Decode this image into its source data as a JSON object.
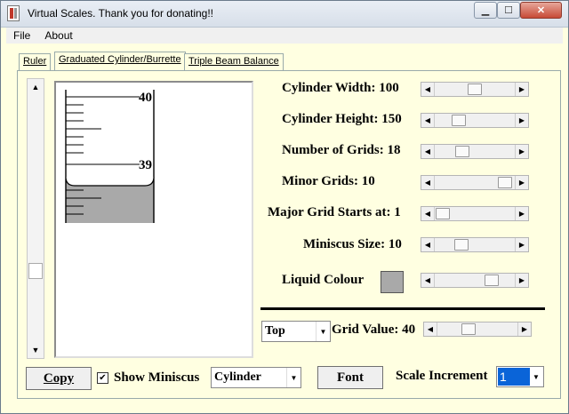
{
  "window": {
    "title": "Virtual Scales.  Thank you for donating!!"
  },
  "menu": {
    "file": "File",
    "about": "About"
  },
  "tabs": {
    "ruler": "Ruler",
    "cylinder": "Graduated Cylinder/Burrette",
    "balance": "Triple Beam Balance"
  },
  "cylinder_view": {
    "upper_label": "40",
    "lower_label": "39",
    "liquid_color": "#a9a9a9"
  },
  "controls": {
    "width": {
      "label": "Cylinder Width: 100",
      "level": 0.5
    },
    "height": {
      "label": "Cylinder Height: 150",
      "level": 0.26
    },
    "grids": {
      "label": "Number of Grids: 18",
      "level": 0.31
    },
    "minor": {
      "label": "Minor Grids: 10",
      "level": 0.96
    },
    "major_start": {
      "label": "Major Grid Starts at: 1",
      "level": 0.02
    },
    "miniscus": {
      "label": "Miniscus Size: 10",
      "level": 0.3
    },
    "colour": {
      "label": "Liquid Colour",
      "level": 0.75
    }
  },
  "grid_value": {
    "position": "Top",
    "label": "Grid Value: 40",
    "level": 0.36
  },
  "bottom": {
    "copy": "Copy",
    "show_miniscus": "Show Miniscus",
    "show_miniscus_checked": true,
    "view_type": "Cylinder",
    "font": "Font",
    "scale_increment_label": "Scale Increment",
    "scale_increment": "1"
  }
}
